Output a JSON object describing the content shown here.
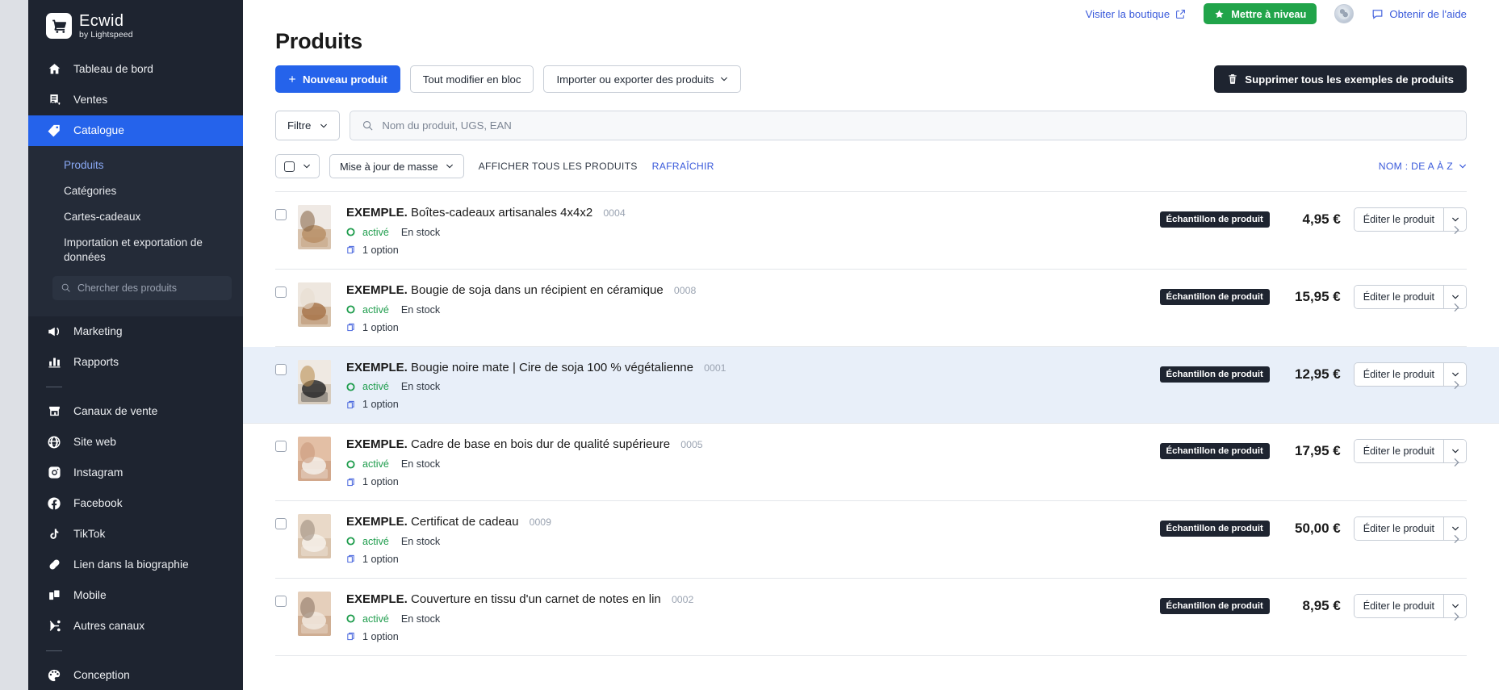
{
  "brand": {
    "name": "Ecwid",
    "sub": "by Lightspeed",
    "logo_icon": "shopping-cart-icon"
  },
  "sidebar": {
    "items": [
      {
        "label": "Tableau de bord",
        "icon": "home-icon",
        "active": false
      },
      {
        "label": "Ventes",
        "icon": "receipt-icon",
        "active": false
      },
      {
        "label": "Catalogue",
        "icon": "tag-icon",
        "active": true
      }
    ],
    "subitems": [
      {
        "label": "Produits",
        "current": true
      },
      {
        "label": "Catégories",
        "current": false
      },
      {
        "label": "Cartes-cadeaux",
        "current": false
      },
      {
        "label": "Importation et exportation de données",
        "current": false
      }
    ],
    "search_placeholder": "Chercher des produits",
    "group2": [
      {
        "label": "Marketing",
        "icon": "megaphone-icon"
      },
      {
        "label": "Rapports",
        "icon": "bar-chart-icon"
      }
    ],
    "group3": [
      {
        "label": "Canaux de vente",
        "icon": "storefront-icon"
      },
      {
        "label": "Site web",
        "icon": "globe-icon"
      },
      {
        "label": "Instagram",
        "icon": "instagram-icon"
      },
      {
        "label": "Facebook",
        "icon": "facebook-icon"
      },
      {
        "label": "TikTok",
        "icon": "tiktok-icon"
      },
      {
        "label": "Lien dans la biographie",
        "icon": "link-icon"
      },
      {
        "label": "Mobile",
        "icon": "mobile-icon"
      },
      {
        "label": "Autres canaux",
        "icon": "share-icon"
      }
    ],
    "group4": [
      {
        "label": "Conception",
        "icon": "palette-icon"
      }
    ]
  },
  "topbar": {
    "visit_store": "Visiter la boutique",
    "upgrade": "Mettre à niveau",
    "help": "Obtenir de l'aide"
  },
  "page": {
    "title": "Produits",
    "new_product": "Nouveau produit",
    "bulk_edit": "Tout modifier en bloc",
    "import_export": "Importer ou exporter des produits",
    "delete_samples": "Supprimer tous les exemples de produits"
  },
  "filters": {
    "filter_label": "Filtre",
    "search_placeholder": "Nom du produit, UGS, EAN",
    "mass_update": "Mise à jour de masse",
    "show_all": "AFFICHER TOUS LES PRODUITS",
    "refresh": "RAFRAÎCHIR",
    "sort": "NOM : DE A À Z"
  },
  "labels": {
    "enabled": "activé",
    "in_stock": "En stock",
    "one_option": "1 option",
    "sample_badge": "Échantillon de produit",
    "edit_product": "Éditer le produit"
  },
  "colors": {
    "accent": "#2563eb",
    "link": "#3b5bdb",
    "green": "#21a44a",
    "status_green": "#1f9d4d",
    "dark": "#1e2430",
    "highlight_row": "#e8eff9"
  },
  "products": [
    {
      "prefix": "EXEMPLE.",
      "name": "Boîtes-cadeaux artisanales 4x4x2",
      "sku": "0004",
      "status": "activé",
      "stock": "En stock",
      "options": "1 option",
      "badge": "Échantillon de produit",
      "price": "4,95 €",
      "highlight": false,
      "thumb": "gift-boxes-photo"
    },
    {
      "prefix": "EXEMPLE.",
      "name": "Bougie de soja dans un récipient en céramique",
      "sku": "0008",
      "status": "activé",
      "stock": "En stock",
      "options": "1 option",
      "badge": "Échantillon de produit",
      "price": "15,95 €",
      "highlight": false,
      "thumb": "ceramic-candles-photo"
    },
    {
      "prefix": "EXEMPLE.",
      "name": "Bougie noire mate | Cire de soja 100 % végétalienne",
      "sku": "0001",
      "status": "activé",
      "stock": "En stock",
      "options": "1 option",
      "badge": "Échantillon de produit",
      "price": "12,95 €",
      "highlight": true,
      "thumb": "black-candle-photo"
    },
    {
      "prefix": "EXEMPLE.",
      "name": "Cadre de base en bois dur de qualité supérieure",
      "sku": "0005",
      "status": "activé",
      "stock": "En stock",
      "options": "1 option",
      "badge": "Échantillon de produit",
      "price": "17,95 €",
      "highlight": false,
      "thumb": "wood-frame-photo"
    },
    {
      "prefix": "EXEMPLE.",
      "name": "Certificat de cadeau",
      "sku": "0009",
      "status": "activé",
      "stock": "En stock",
      "options": "1 option",
      "badge": "Échantillon de produit",
      "price": "50,00 €",
      "highlight": false,
      "thumb": "gift-certificate-photo"
    },
    {
      "prefix": "EXEMPLE.",
      "name": "Couverture en tissu d'un carnet de notes en lin",
      "sku": "0002",
      "status": "activé",
      "stock": "En stock",
      "options": "1 option",
      "badge": "Échantillon de produit",
      "price": "8,95 €",
      "highlight": false,
      "thumb": "linen-notebook-photo"
    }
  ]
}
